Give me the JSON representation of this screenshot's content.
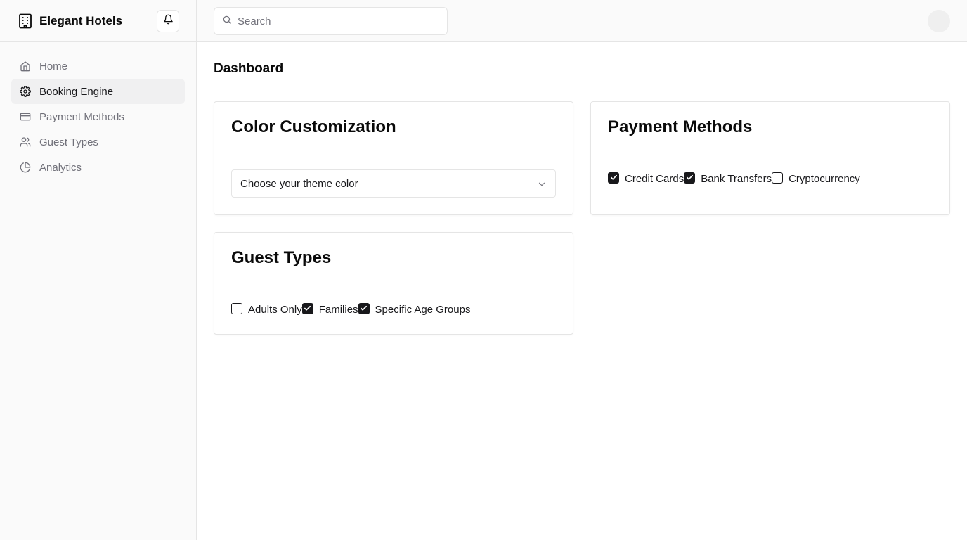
{
  "brand": {
    "name": "Elegant Hotels"
  },
  "sidebar": {
    "items": [
      {
        "label": "Home",
        "icon": "home-icon"
      },
      {
        "label": "Booking Engine",
        "icon": "gear-icon",
        "active": true
      },
      {
        "label": "Payment Methods",
        "icon": "credit-card-icon"
      },
      {
        "label": "Guest Types",
        "icon": "users-icon"
      },
      {
        "label": "Analytics",
        "icon": "pie-chart-icon"
      }
    ]
  },
  "search": {
    "placeholder": "Search"
  },
  "main": {
    "title": "Dashboard",
    "color_card": {
      "title": "Color Customization",
      "select_value": "Choose your theme color"
    },
    "payment_card": {
      "title": "Payment Methods",
      "options": [
        {
          "label": "Credit Cards",
          "checked": true
        },
        {
          "label": "Bank Transfers",
          "checked": true
        },
        {
          "label": "Cryptocurrency",
          "checked": false
        }
      ]
    },
    "guest_card": {
      "title": "Guest Types",
      "options": [
        {
          "label": "Adults Only",
          "checked": false
        },
        {
          "label": "Families",
          "checked": true
        },
        {
          "label": "Specific Age Groups",
          "checked": true
        }
      ]
    }
  },
  "colors": {
    "sidebar_bg": "#fafafa",
    "active_item_bg": "#f0f0f1",
    "border": "#e5e5e5",
    "muted_text": "#71717a",
    "primary": "#18181b"
  }
}
